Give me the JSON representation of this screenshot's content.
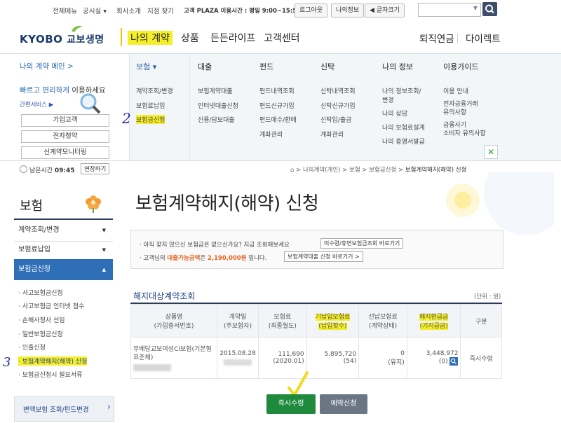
{
  "util": {
    "links": [
      "전체메뉴",
      "공시실 ▾",
      "회사소개",
      "지점 찾기"
    ],
    "plaza": "고객 PLAZA 이용시간 : 평일 9:00~15:50",
    "logout": "로그아웃",
    "myinfo": "나의정보",
    "fontsize": "글자크기"
  },
  "brand": {
    "en": "KYOBO",
    "ko": "교보생명"
  },
  "gnb": [
    "나의 계약",
    "상품",
    "든든라이프",
    "고객센터"
  ],
  "gnb_right": [
    "퇴직연금",
    "다이렉트"
  ],
  "mega": {
    "left_title": "나의 계약 메인 >",
    "slogan_a": "빠르고 편리하게 ",
    "slogan_b": "이용하세요",
    "service": "간편서비스 ▶",
    "buttons": [
      "기업고객",
      "전자청약",
      "신계약모니터링"
    ],
    "columns": [
      {
        "head": "보험 ▾",
        "items": [
          "계약조회/변경",
          "보험료납입",
          "보험금신청"
        ]
      },
      {
        "head": "대출",
        "items": [
          "보험계약대출",
          "인터넷대출신청",
          "신용/담보대출"
        ]
      },
      {
        "head": "펀드",
        "items": [
          "펀드내역조회",
          "펀드신규가입",
          "펀드매수/환매",
          "계좌관리"
        ]
      },
      {
        "head": "신탁",
        "items": [
          "신탁내역조회",
          "신탁신규가입",
          "신탁입/출금",
          "계좌관리"
        ]
      },
      {
        "head": "나의 정보",
        "items": [
          "나의 정보조회/",
          "변경",
          "나의 상담",
          "나의 보험료설계",
          "나의 증명서발급"
        ]
      },
      {
        "head": "이용가이드",
        "items": [
          "이용 안내",
          "전자금융거래",
          "유의사항",
          "금융사기",
          "소비자 유의사항"
        ]
      }
    ],
    "close": "✕"
  },
  "session": {
    "label": "남은시간",
    "time": "09:45",
    "extend": "연장하기"
  },
  "breadcrumb": [
    "⌂",
    "나의계약(개인)",
    "보험",
    "보험금신청",
    "보험계약해지(해약) 신청"
  ],
  "sidebar": {
    "title": "보험",
    "items": [
      "계약조회/변경",
      "보험료납입",
      "보험금신청"
    ],
    "subs": [
      "사고보험금신청",
      "사고보험금 인터넷 접수",
      "손해사정사 선임",
      "일반보험금신청",
      "인출신청",
      "보험계약해지(해약) 신청",
      "보험금신청시 필요서류"
    ],
    "promo": "변액보험 조회/펀드변경"
  },
  "page_title": "보험계약해지(해약) 신청",
  "notice": {
    "line1": "아직 찾지 않으신 보험금은 없으신가요? 지금 조회해보세요",
    "btn1": "미수령/휴면보험금조회 바로가기",
    "line2_a": "고객님의 ",
    "line2_b": "대출가능금액",
    "line2_c": "은 ",
    "line2_d": "2,190,000원",
    "line2_e": " 입니다.",
    "btn2": "보험계약대출 신청 바로가기 >"
  },
  "section": {
    "title": "해지대상계약조회",
    "unit": "(단위 : 원)"
  },
  "table": {
    "headers": [
      [
        "상품명",
        "(가입증서번호)"
      ],
      [
        "계약일",
        "(주보험자)"
      ],
      [
        "보험료",
        "(최종월도)"
      ],
      [
        "기납입보험료",
        "(납입횟수)"
      ],
      [
        "선납보험료",
        "(계약상태)"
      ],
      [
        "해지환급금",
        "(기지급금)"
      ],
      [
        "구분",
        ""
      ]
    ],
    "row": {
      "product": "무배당교보여성CI보험(기본형 표준체)",
      "date": "2015.08.28",
      "premium": "111,690",
      "premium_month": "(2020.01)",
      "paid": "5,895,720",
      "paid_count": "(54)",
      "prepaid": "0",
      "status": "(유지)",
      "refund": "3,448,972",
      "refund_paid": "(0)",
      "type": "즉시수령"
    }
  },
  "actions": {
    "primary": "즉시수령",
    "secondary": "예약신청"
  },
  "annotations": {
    "n2": "2",
    "n3": "3"
  }
}
